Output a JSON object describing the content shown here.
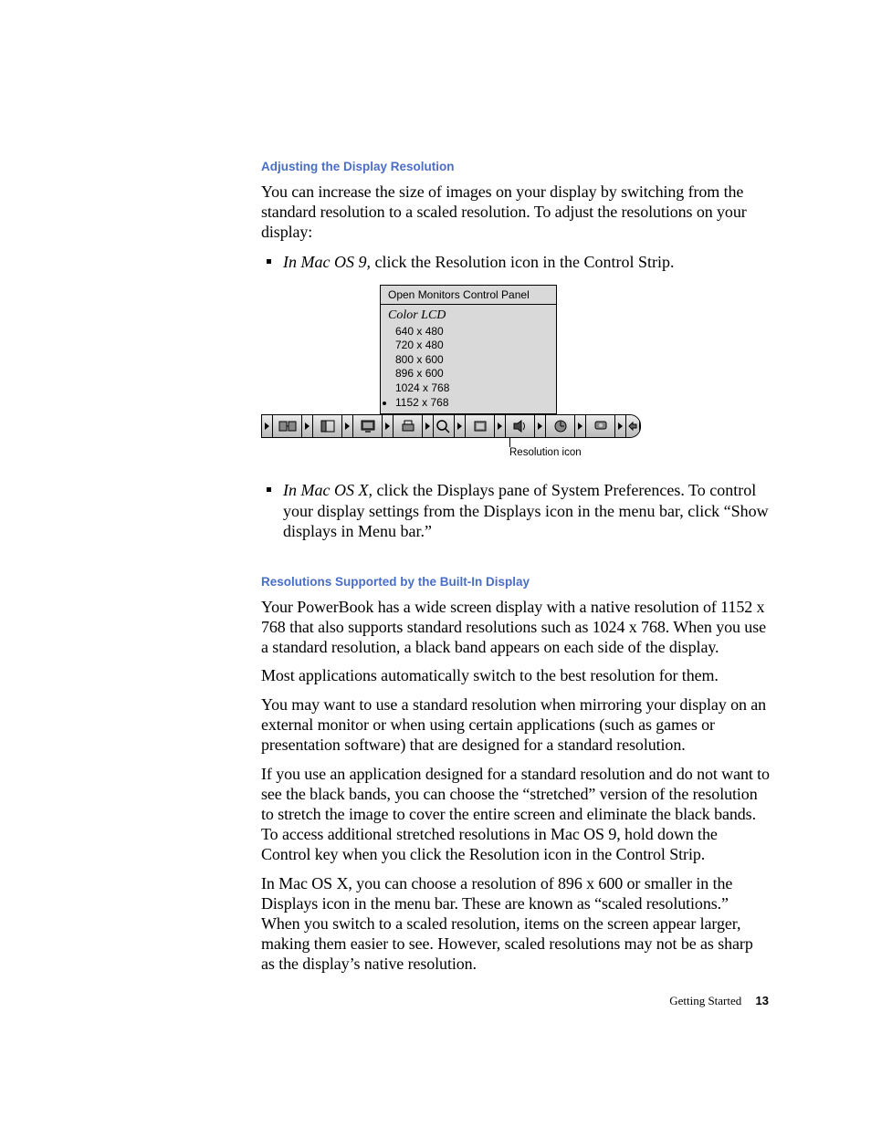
{
  "section1": {
    "heading": "Adjusting the Display Resolution",
    "intro": "You can increase the size of images on your display by switching from the standard resolution to a scaled resolution. To adjust the resolutions on your display:",
    "bullet1_prefix": "In Mac OS 9,",
    "bullet1_rest": " click the Resolution icon in the Control Strip.",
    "bullet2_prefix": "In Mac OS X,",
    "bullet2_rest": " click the Displays pane of System Preferences. To control your display settings from the Displays icon in the menu bar, click “Show displays in Menu bar.”"
  },
  "popup": {
    "header": "Open Monitors Control Panel",
    "title": "Color LCD",
    "items": [
      {
        "label": "640 x 480",
        "selected": false
      },
      {
        "label": "720 x 480",
        "selected": false
      },
      {
        "label": "800 x 600",
        "selected": false
      },
      {
        "label": "896 x 600",
        "selected": false
      },
      {
        "label": "1024 x 768",
        "selected": false
      },
      {
        "label": "1152 x 768",
        "selected": true
      }
    ]
  },
  "strip_icons": [
    "arrow-icon",
    "filesharing-icon",
    "arrow-icon",
    "finder-icon",
    "arrow-icon",
    "monitor-icon",
    "arrow-icon",
    "printer-icon",
    "arrow-icon",
    "zoom-icon",
    "arrow-icon",
    "appletalk-icon",
    "arrow-icon",
    "speaker-icon",
    "arrow-icon",
    "cpu-icon",
    "arrow-icon",
    "energy-icon",
    "arrow-icon",
    "keyboard-icon",
    "end-tab-icon"
  ],
  "callout": "Resolution icon",
  "section2": {
    "heading": "Resolutions Supported by the Built-In Display",
    "p1": "Your PowerBook has a wide screen display with a native resolution of 1152 x 768 that also supports standard resolutions such as 1024 x 768. When you use a standard resolution, a black band appears on each side of the display.",
    "p2": "Most applications automatically switch to the best resolution for them.",
    "p3": "You may want to use a standard resolution when mirroring your display on an external monitor or when using certain applications (such as games or presentation software) that are designed for a standard resolution.",
    "p4": "If you use an application designed for a standard resolution and do not want to see the black bands, you can choose the “stretched” version of the resolution to stretch the image to cover the entire screen and eliminate the black bands. To access additional stretched resolutions in Mac OS 9, hold down the Control key when you click the Resolution icon in the Control Strip.",
    "p5": "In Mac OS X, you can choose a resolution of 896 x 600 or smaller in the Displays icon in the menu bar. These are known as “scaled resolutions.” When you switch to a scaled resolution, items on the screen appear larger, making them easier to see. However, scaled resolutions may not be as sharp as the display’s native resolution."
  },
  "footer": {
    "chapter": "Getting Started",
    "page": "13"
  }
}
